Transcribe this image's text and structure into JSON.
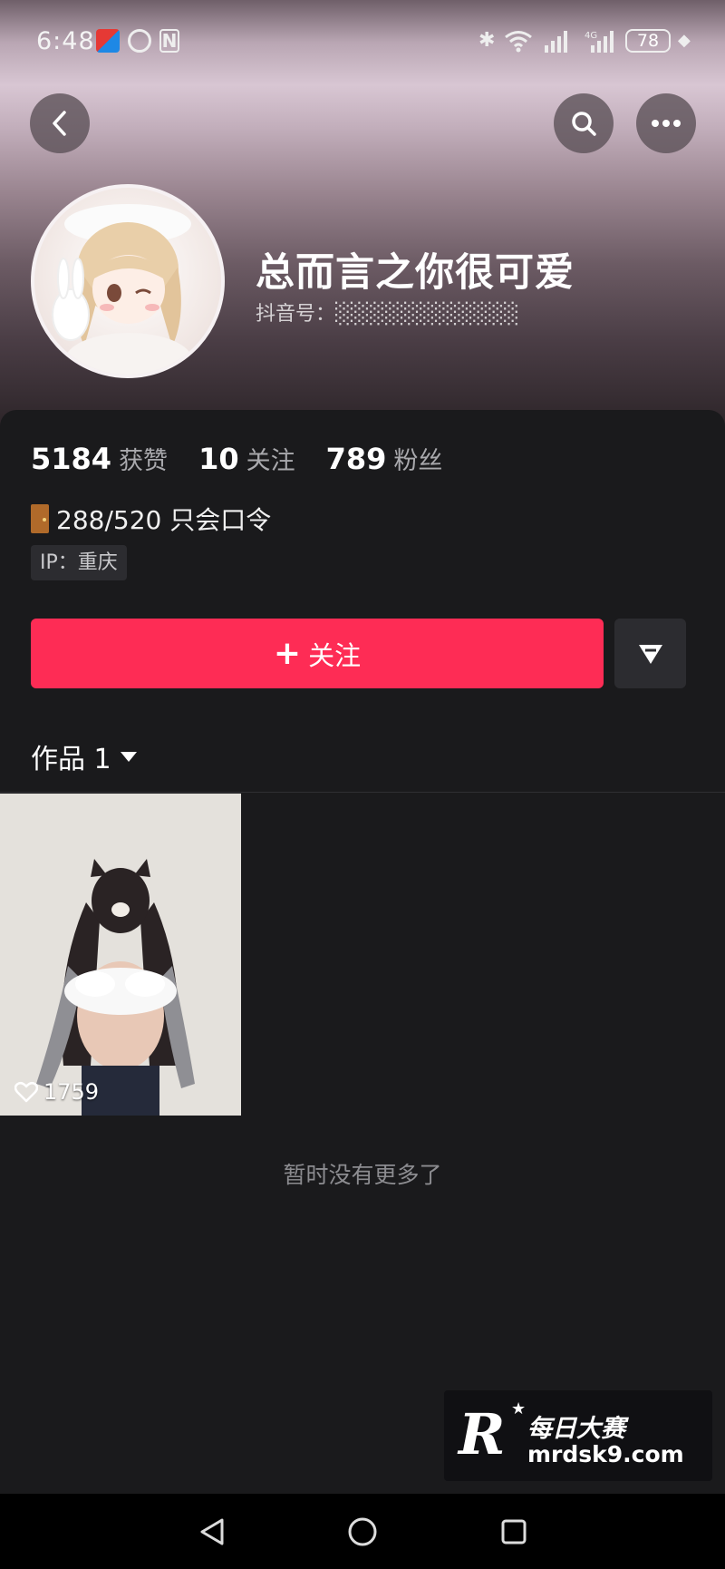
{
  "status_bar": {
    "time": "6:48",
    "nfc_label": "N",
    "battery": "78"
  },
  "profile": {
    "nickname": "总而言之你很可爱",
    "douyin_id": "抖音号：░░░░░░░░░░░░"
  },
  "stats": [
    {
      "value": "5184",
      "label": "获赞"
    },
    {
      "value": "10",
      "label": "关注"
    },
    {
      "value": "789",
      "label": "粉丝"
    }
  ],
  "bio": "288/520 只会口令",
  "ip_tag": "IP：重庆",
  "actions": {
    "follow_plus": "+",
    "follow_label": "关注"
  },
  "works_tab": {
    "label": "作品 1"
  },
  "videos": [
    {
      "likes": "1759"
    }
  ],
  "empty_hint": "暂时没有更多了",
  "watermark": {
    "logo": "R",
    "title": "每日大赛",
    "url": "mrdsk9.com"
  },
  "colors": {
    "accent": "#fe2c55",
    "background": "#1a1a1c"
  }
}
